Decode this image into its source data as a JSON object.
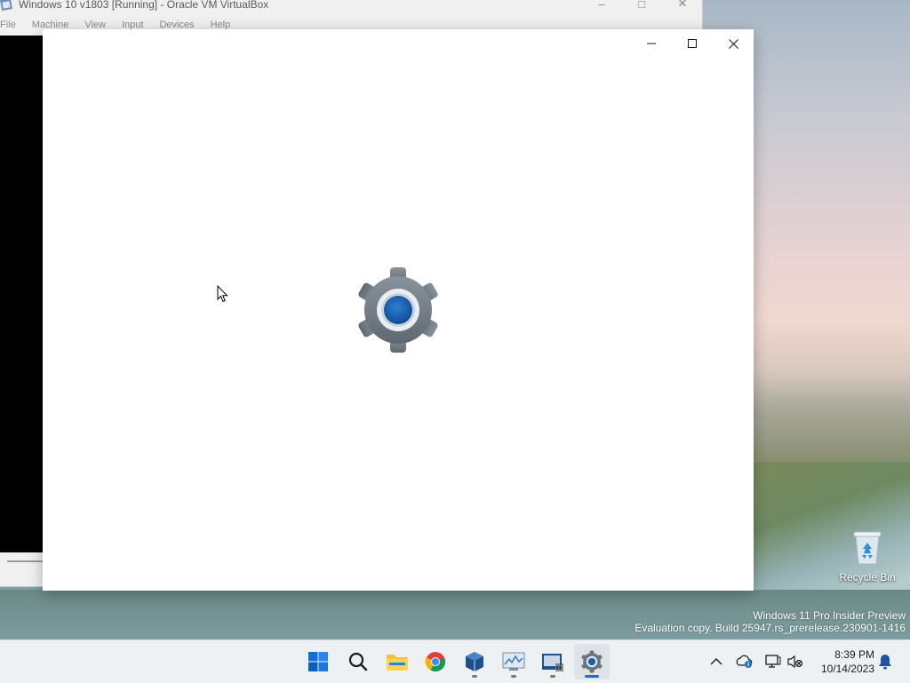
{
  "vbox": {
    "title": "Windows 10 v1803 [Running] - Oracle VM VirtualBox",
    "menu": [
      "File",
      "Machine",
      "View",
      "Input",
      "Devices",
      "Help"
    ],
    "controls": {
      "minimize": "–",
      "maximize": "□",
      "close": "✕"
    }
  },
  "settings_window": {
    "controls": {
      "minimize": "–",
      "maximize": "□",
      "close": "✕"
    },
    "splash_icon": "gear-icon",
    "accent": "#1b5fad"
  },
  "desktop": {
    "recycle_bin_label": "Recycle Bin",
    "watermark": {
      "line1": "Windows 11 Pro Insider Preview",
      "line2": "Evaluation copy. Build 25947.rs_prerelease.230901-1416"
    }
  },
  "taskbar": {
    "apps": [
      {
        "name": "start-icon"
      },
      {
        "name": "search-icon"
      },
      {
        "name": "file-explorer-icon"
      },
      {
        "name": "chrome-icon"
      },
      {
        "name": "virtualbox-icon"
      },
      {
        "name": "performance-monitor-icon"
      },
      {
        "name": "vbox-vm-icon"
      },
      {
        "name": "settings-icon"
      }
    ],
    "tray": {
      "time": "8:39 PM",
      "date": "10/14/2023"
    }
  }
}
